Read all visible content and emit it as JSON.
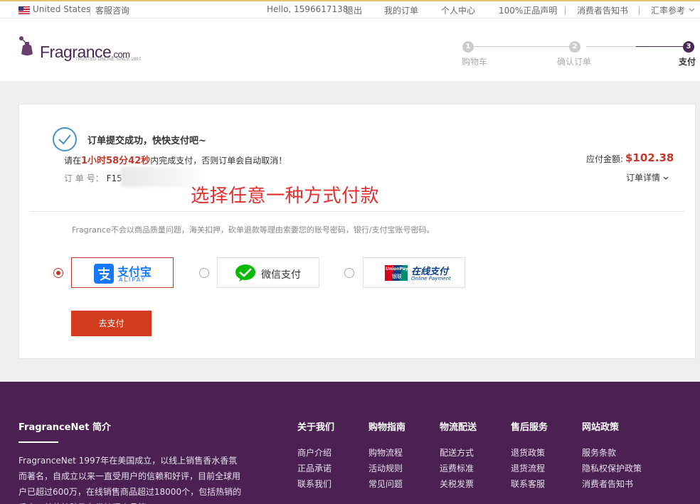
{
  "topbar": {
    "country": "United States",
    "service": "客服咨询",
    "greeting": "Hello, 1596617138",
    "logout": "退出",
    "my_orders": "我的订单",
    "account": "个人中心",
    "authentic": "100%正品声明",
    "consumer_notice": "消费者告知书",
    "exchange_rate": "汇率参考"
  },
  "header": {
    "logo": "Fragrance",
    "logo_suffix": ".com",
    "tagline": "TRUSTED ONLINE SINCE 1997",
    "steps": [
      {
        "num": "1",
        "label": "购物车"
      },
      {
        "num": "2",
        "label": "确认订单"
      },
      {
        "num": "3",
        "label": "支付"
      }
    ]
  },
  "order": {
    "success_title": "订单提交成功，快快支付吧~",
    "pay_prefix": "请在",
    "pay_time": "1小时58分42秒",
    "pay_suffix": "内完成支付，否则订单会自动取消！",
    "order_no_label": "订 单 号：",
    "order_no": "F15",
    "amount_label": "应付金额:",
    "amount": "$102.38",
    "details_link": "订单详情",
    "annotation": "选择任意一种方式付款",
    "notice": "Fragrance不会以商品质量问题，海关扣押，砍单退款等理由索要您的账号密码，银行/支付宝账号密码。",
    "payment_methods": [
      {
        "name": "支付宝",
        "sub": "ALIPAY",
        "icon": "alipay-icon",
        "color": "#1677ff"
      },
      {
        "name": "微信支付",
        "icon": "wechat-icon",
        "color": "#09bb07"
      },
      {
        "name": "在线支付",
        "sub": "Online Payment",
        "badge": "UnionPay",
        "badge_sub": "银联",
        "icon": "unionpay-icon"
      }
    ],
    "go_pay": "去支付"
  },
  "footer": {
    "about_title": "FragranceNet 简介",
    "about_text": "FragranceNet 1997年在美国成立，以线上销售香水香氛而著名，自成立以来一直受用户的信赖和好评，目前全球用户已超过600万，在线销售商品超过18000个，包括热销的香水、美妆护肤及各类护理产品等。",
    "columns": [
      {
        "title": "关于我们",
        "links": [
          "商户介绍",
          "正品承诺",
          "联系我们"
        ]
      },
      {
        "title": "购物指南",
        "links": [
          "购物流程",
          "活动规则",
          "常见问题"
        ]
      },
      {
        "title": "物流配送",
        "links": [
          "配送方式",
          "运费标准",
          "关税发票"
        ]
      },
      {
        "title": "售后服务",
        "links": [
          "退货政策",
          "退货流程",
          "联系客服"
        ]
      },
      {
        "title": "网站政策",
        "links": [
          "服务条款",
          "隐私权保护政策",
          "消费者告知书"
        ]
      }
    ]
  },
  "colors": {
    "brand": "#4a2a52",
    "footer_bg": "#4a2150",
    "accent_red": "#c0392b",
    "button_red": "#d23b1c"
  }
}
